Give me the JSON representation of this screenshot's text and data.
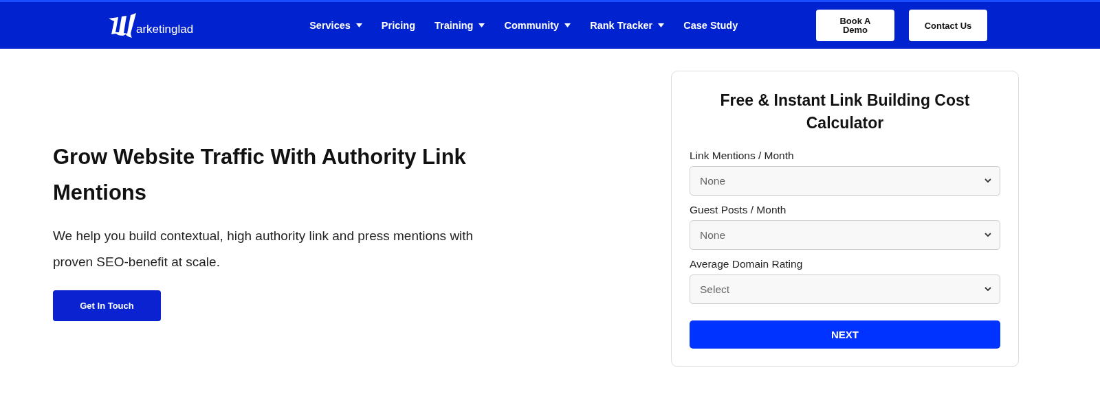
{
  "header": {
    "logo_text": "arketinglad",
    "nav": [
      {
        "label": "Services",
        "dropdown": true
      },
      {
        "label": "Pricing",
        "dropdown": false
      },
      {
        "label": "Training",
        "dropdown": true
      },
      {
        "label": "Community",
        "dropdown": true
      },
      {
        "label": "Rank Tracker",
        "dropdown": true
      },
      {
        "label": "Case Study",
        "dropdown": false
      }
    ],
    "buttons": [
      "Book A Demo",
      "Contact Us"
    ]
  },
  "hero": {
    "heading": "Grow Website Traffic With Authority Link Mentions",
    "text": "We help you build contextual, high authority link and press mentions with proven SEO-benefit at scale.",
    "button": "Get In Touch"
  },
  "calculator": {
    "title": "Free & Instant Link Building Cost Calculator",
    "fields": [
      {
        "label": "Link Mentions / Month",
        "value": "None"
      },
      {
        "label": "Guest Posts / Month",
        "value": "None"
      },
      {
        "label": "Average Domain Rating",
        "value": "Select"
      }
    ],
    "button": "NEXT"
  }
}
